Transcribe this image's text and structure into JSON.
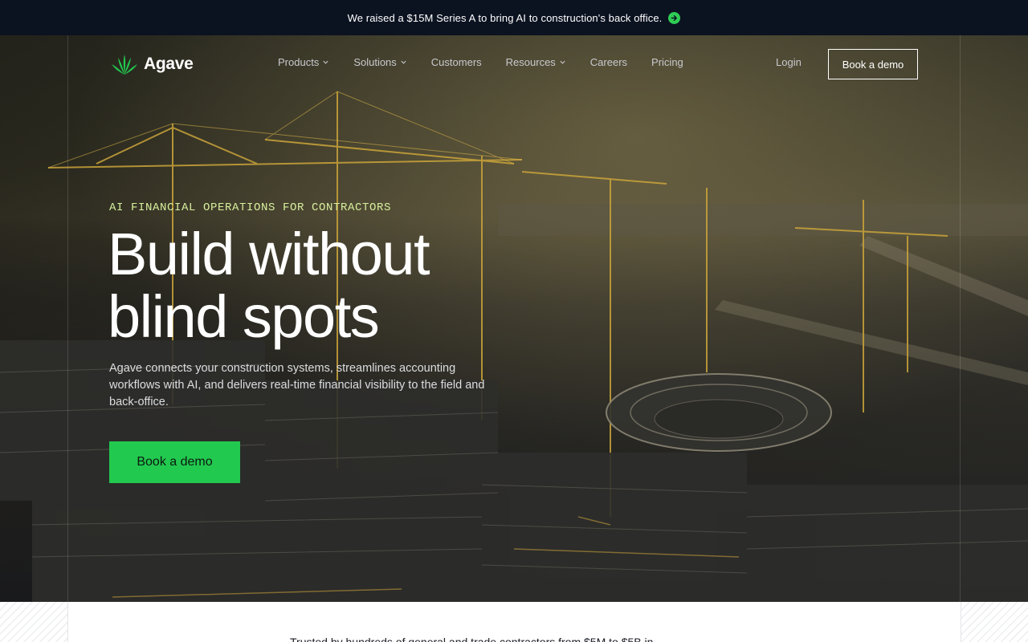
{
  "announcement": {
    "text": "We raised a $15M Series A to bring AI to construction's back office.",
    "arrow_icon": "arrow-right-circle-icon",
    "accent_color": "#2ecc55"
  },
  "nav": {
    "brand": "Agave",
    "logo_icon": "agave-leaf-icon",
    "items": [
      {
        "label": "Products",
        "has_dropdown": true
      },
      {
        "label": "Solutions",
        "has_dropdown": true
      },
      {
        "label": "Customers",
        "has_dropdown": false
      },
      {
        "label": "Resources",
        "has_dropdown": true
      },
      {
        "label": "Careers",
        "has_dropdown": false
      },
      {
        "label": "Pricing",
        "has_dropdown": false
      }
    ],
    "login_label": "Login",
    "cta_label": "Book a demo"
  },
  "hero": {
    "eyebrow": "AI FINANCIAL OPERATIONS FOR CONTRACTORS",
    "headline_line1": "Build without",
    "headline_line2": "blind spots",
    "subcopy": "Agave connects your construction systems, streamlines accounting workflows with AI, and delivers real-time financial visibility to the field and back-office.",
    "cta_label": "Book a demo",
    "cta_color": "#22c94f"
  },
  "trusted": {
    "text": "Trusted by hundreds of general and trade contractors from $5M to $5B in"
  }
}
